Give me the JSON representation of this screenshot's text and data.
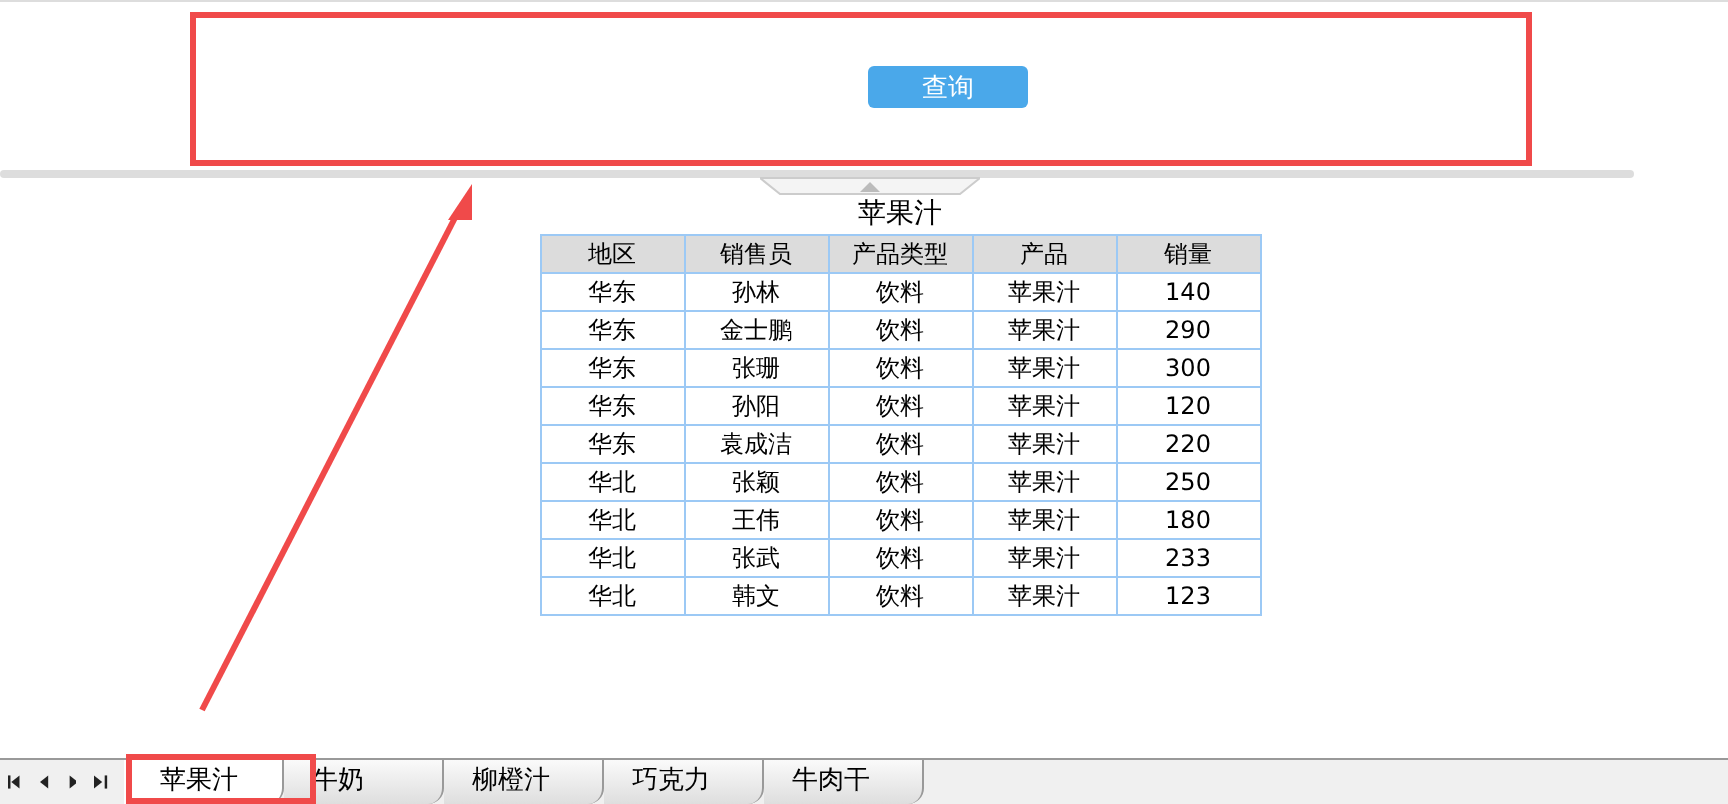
{
  "query_button": "查询",
  "report": {
    "title": "苹果汁",
    "columns": [
      "地区",
      "销售员",
      "产品类型",
      "产品",
      "销量"
    ],
    "rows": [
      [
        "华东",
        "孙林",
        "饮料",
        "苹果汁",
        "140"
      ],
      [
        "华东",
        "金士鹏",
        "饮料",
        "苹果汁",
        "290"
      ],
      [
        "华东",
        "张珊",
        "饮料",
        "苹果汁",
        "300"
      ],
      [
        "华东",
        "孙阳",
        "饮料",
        "苹果汁",
        "120"
      ],
      [
        "华东",
        "袁成洁",
        "饮料",
        "苹果汁",
        "220"
      ],
      [
        "华北",
        "张颖",
        "饮料",
        "苹果汁",
        "250"
      ],
      [
        "华北",
        "王伟",
        "饮料",
        "苹果汁",
        "180"
      ],
      [
        "华北",
        "张武",
        "饮料",
        "苹果汁",
        "233"
      ],
      [
        "华北",
        "韩文",
        "饮料",
        "苹果汁",
        "123"
      ]
    ]
  },
  "sheet_tabs": [
    {
      "label": "苹果汁",
      "selected": true
    },
    {
      "label": "牛奶",
      "selected": false
    },
    {
      "label": "柳橙汁",
      "selected": false
    },
    {
      "label": "巧克力",
      "selected": false
    },
    {
      "label": "牛肉干",
      "selected": false
    }
  ]
}
